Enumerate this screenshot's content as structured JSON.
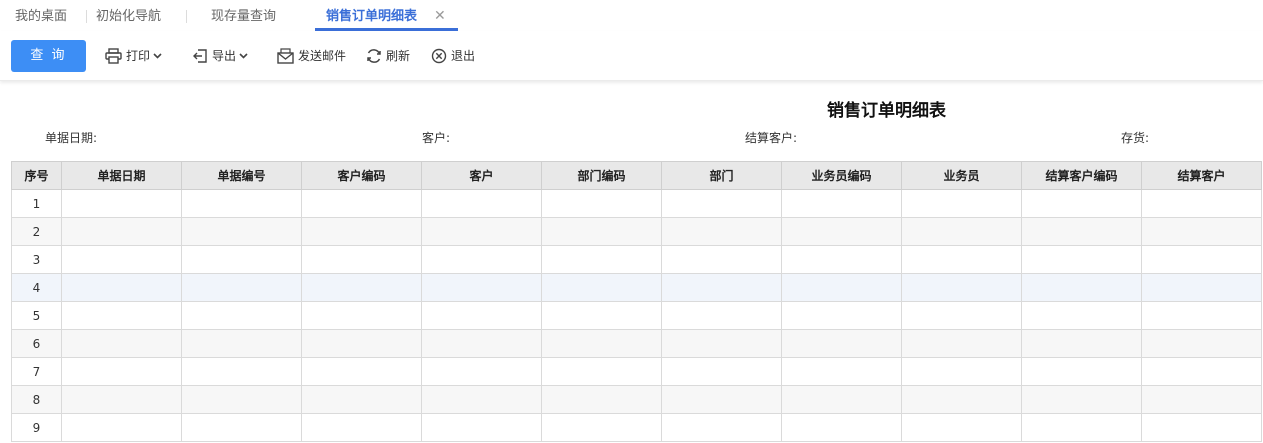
{
  "tabs": [
    {
      "label": "我的桌面",
      "active": false
    },
    {
      "label": "初始化导航",
      "active": false
    },
    {
      "label": "现存量查询",
      "active": false
    },
    {
      "label": "销售订单明细表",
      "active": true
    }
  ],
  "toolbar": {
    "query_label": "查 询",
    "print_label": "打印",
    "export_label": "导出",
    "email_label": "发送邮件",
    "refresh_label": "刷新",
    "exit_label": "退出"
  },
  "report": {
    "title": "销售订单明细表",
    "filters": {
      "date_label": "单据日期:",
      "customer_label": "客户:",
      "settle_label": "结算客户:",
      "stock_label": "存货:"
    }
  },
  "table": {
    "columns": [
      "序号",
      "单据日期",
      "单据编号",
      "客户编码",
      "客户",
      "部门编码",
      "部门",
      "业务员编码",
      "业务员",
      "结算客户编码",
      "结算客户"
    ],
    "row_numbers": [
      "1",
      "2",
      "3",
      "4",
      "5",
      "6",
      "7",
      "8",
      "9"
    ],
    "highlighted_row": "4"
  },
  "colors": {
    "accent": "#3d8ef5",
    "tab_active": "#3b6fd8",
    "header_bg": "#e8e8e8",
    "row_highlight": "#f1f5fb"
  },
  "icons": [
    "printer-icon",
    "export-icon",
    "email-icon",
    "refresh-icon",
    "exit-icon",
    "chevron-down-icon",
    "close-icon"
  ]
}
